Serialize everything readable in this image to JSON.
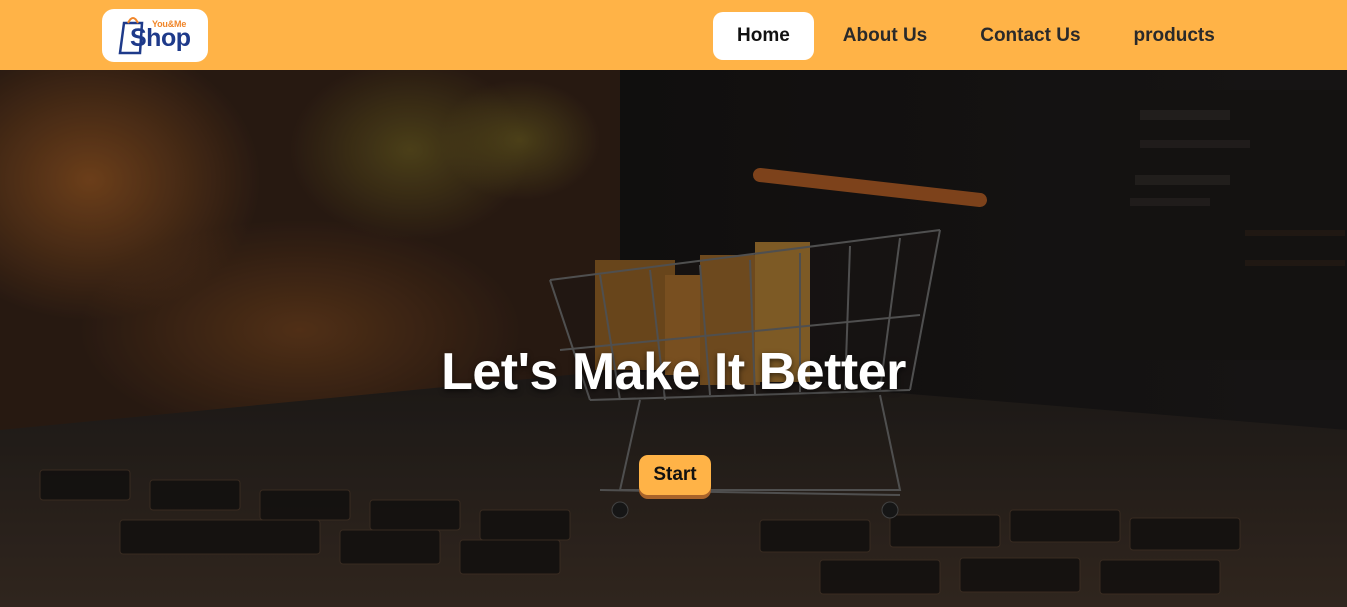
{
  "logo": {
    "small_text": "You&Me",
    "big_text": "Shop",
    "icon": "shopping-bag-icon"
  },
  "nav": {
    "items": [
      {
        "label": "Home",
        "active": true
      },
      {
        "label": "About Us",
        "active": false
      },
      {
        "label": "Contact Us",
        "active": false
      },
      {
        "label": "products",
        "active": false
      }
    ]
  },
  "hero": {
    "title": "Let's Make It Better",
    "button_label": "Start",
    "background": "shopping-cart-on-laptop-keyboard"
  },
  "colors": {
    "accent": "#ffb347",
    "logo_blue": "#1e3a8a",
    "logo_orange": "#f0862a"
  }
}
